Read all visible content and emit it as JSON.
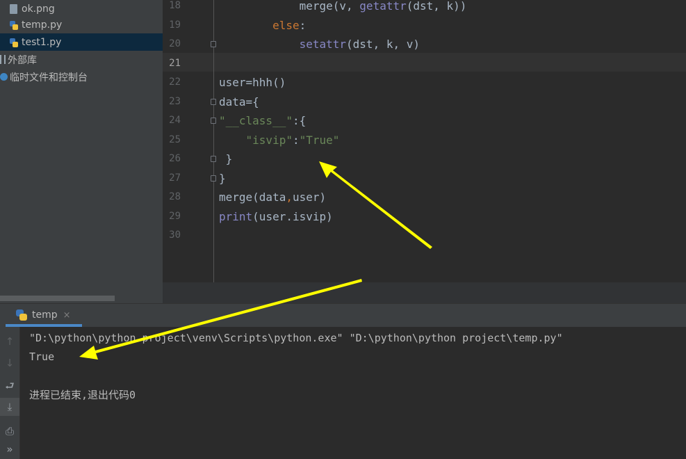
{
  "project_tree": {
    "items": [
      {
        "label": "ok.png",
        "icon": "png-file-icon"
      },
      {
        "label": "temp.py",
        "icon": "python-file-icon"
      },
      {
        "label": "test1.py",
        "icon": "python-file-icon",
        "selected": true
      },
      {
        "label": "外部库",
        "icon": "library-icon"
      },
      {
        "label": "临时文件和控制台",
        "icon": "scratches-icon"
      }
    ]
  },
  "editor": {
    "current_line": 21,
    "lines": [
      {
        "no": "18",
        "indent": "            ",
        "tokens": [
          {
            "t": "merge(v, "
          },
          {
            "t": "getattr",
            "c": "bi"
          },
          {
            "t": "(dst, k))"
          }
        ]
      },
      {
        "no": "19",
        "indent": "        ",
        "tokens": [
          {
            "t": "else",
            "c": "kw"
          },
          {
            "t": ":"
          }
        ]
      },
      {
        "no": "20",
        "indent": "            ",
        "tokens": [
          {
            "t": "setattr",
            "c": "bi"
          },
          {
            "t": "(dst, k, v)"
          }
        ]
      },
      {
        "no": "21",
        "indent": "",
        "tokens": []
      },
      {
        "no": "22",
        "indent": "",
        "tokens": [
          {
            "t": "user=hhh()"
          }
        ]
      },
      {
        "no": "23",
        "indent": "",
        "tokens": [
          {
            "t": "data={"
          }
        ]
      },
      {
        "no": "24",
        "indent": "",
        "tokens": [
          {
            "t": "\"__class__\"",
            "c": "str"
          },
          {
            "t": ":{"
          }
        ]
      },
      {
        "no": "25",
        "indent": "    ",
        "tokens": [
          {
            "t": "\"isvip\"",
            "c": "str"
          },
          {
            "t": ":"
          },
          {
            "t": "\"True\"",
            "c": "str"
          }
        ]
      },
      {
        "no": "26",
        "indent": " ",
        "tokens": [
          {
            "t": "}"
          }
        ]
      },
      {
        "no": "27",
        "indent": "",
        "tokens": [
          {
            "t": "}"
          }
        ]
      },
      {
        "no": "28",
        "indent": "",
        "tokens": [
          {
            "t": "merge(data"
          },
          {
            "t": ",",
            "c": "kw"
          },
          {
            "t": "user)"
          }
        ]
      },
      {
        "no": "29",
        "indent": "",
        "tokens": [
          {
            "t": "print",
            "c": "bi"
          },
          {
            "t": "(user.isvip)"
          }
        ]
      },
      {
        "no": "30",
        "indent": "",
        "tokens": []
      }
    ]
  },
  "run_panel": {
    "tab_label": "temp",
    "close_glyph": "×",
    "output": [
      "\"D:\\python\\python project\\venv\\Scripts\\python.exe\" \"D:\\python\\python project\\temp.py\"",
      "True",
      "",
      "进程已结束,退出代码0"
    ],
    "toolbar": [
      {
        "name": "up-icon",
        "glyph": "↑"
      },
      {
        "name": "down-icon",
        "glyph": "↓"
      },
      {
        "name": "soft-wrap-icon",
        "glyph": "⮐"
      },
      {
        "name": "scroll-to-end-icon",
        "glyph": "⤓"
      },
      {
        "name": "print-icon",
        "glyph": "⎙"
      },
      {
        "name": "more-icon",
        "glyph": "»"
      }
    ]
  },
  "colors": {
    "editor_bg": "#2b2b2b",
    "tree_bg": "#3c3f41",
    "selection": "#0d293e",
    "keyword": "#cc7832",
    "builtin": "#8888c6",
    "string": "#6a8759",
    "arrow": "#ffff00"
  }
}
